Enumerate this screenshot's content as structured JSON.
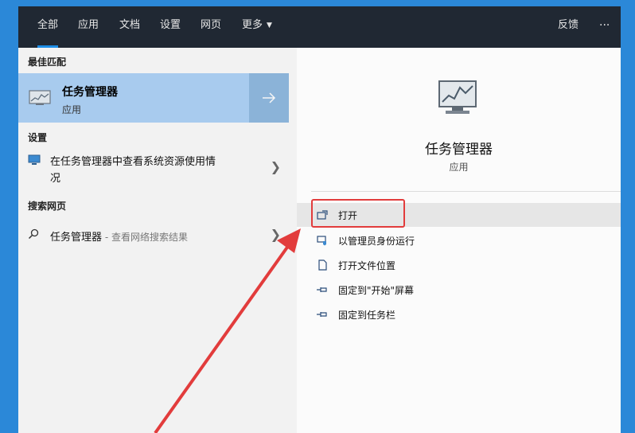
{
  "tabs": [
    "全部",
    "应用",
    "文档",
    "设置",
    "网页",
    "更多"
  ],
  "topbar_right": {
    "feedback": "反馈",
    "more": "···"
  },
  "left": {
    "best_match_label": "最佳匹配",
    "best_match": {
      "title": "任务管理器",
      "subtitle": "应用"
    },
    "settings_label": "设置",
    "settings_item_line1": "在任务管理器中查看系统资源使用情",
    "settings_item_line2": "况",
    "web_label": "搜索网页",
    "web_item_title": "任务管理器",
    "web_item_suffix": " - 查看网络搜索结果"
  },
  "right": {
    "app_title": "任务管理器",
    "app_subtitle": "应用",
    "actions": [
      "打开",
      "以管理员身份运行",
      "打开文件位置",
      "固定到\"开始\"屏幕",
      "固定到任务栏"
    ]
  },
  "colors": {
    "accent": "#1d8de6",
    "highlight_box": "#e23c3c",
    "arrow": "#e23c3c"
  }
}
